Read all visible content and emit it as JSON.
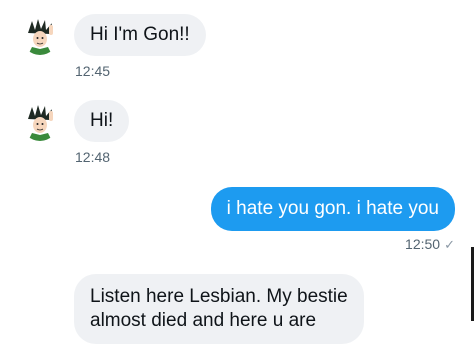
{
  "messages": [
    {
      "sender": "contact",
      "text": "Hi I'm Gon!!",
      "time": "12:45"
    },
    {
      "sender": "contact",
      "text": "Hi!",
      "time": "12:48"
    },
    {
      "sender": "self",
      "text": "i hate you gon. i hate you",
      "time": "12:50",
      "status_icon": "sent-check-icon"
    },
    {
      "sender": "contact",
      "text_line1": "Listen here Lesbian. My bestie",
      "text_line2": "almost died and here u are"
    }
  ],
  "status_glyph": "✓",
  "colors": {
    "incoming_bubble": "#eff1f4",
    "outgoing_bubble": "#1d9bf0",
    "timestamp": "#536471"
  }
}
